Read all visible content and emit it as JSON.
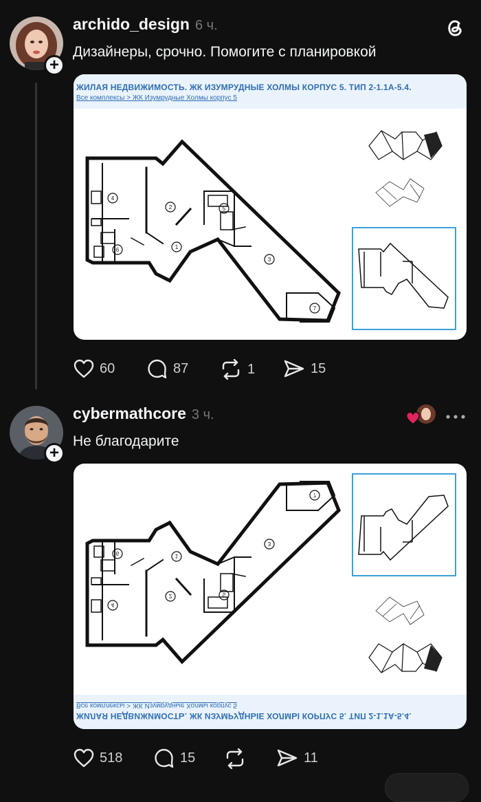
{
  "post1": {
    "username": "archido_design",
    "time": "6 ч.",
    "text": "Дизайнеры, срочно. Помогите с планировкой",
    "card": {
      "title": "ЖИЛАЯ НЕДВИЖИМОСТЬ. ЖК ИЗУМРУДНЫЕ ХОЛМЫ КОРПУС 5. ТИП 2-1.1А-5.4.",
      "breadcrumb": "Все комплексы > ЖК Изумрудные Холмы корпус 5",
      "rooms": [
        "1",
        "2",
        "3",
        "4",
        "5",
        "6",
        "7"
      ]
    },
    "actions": {
      "likes": "60",
      "comments": "87",
      "reposts": "1",
      "shares": "15"
    }
  },
  "post2": {
    "username": "cybermathcore",
    "time": "3 ч.",
    "text": "Не благодарите",
    "actions": {
      "likes": "518",
      "comments": "15",
      "reposts": "",
      "shares": "11"
    }
  },
  "colors": {
    "background": "#101010",
    "text": "#f3f5f7",
    "muted": "#777777",
    "like_red": "#e0245e",
    "plan_blue": "#2e6db4"
  },
  "icons": [
    "threads-logo-icon",
    "plus-icon",
    "heart-icon",
    "comment-icon",
    "repost-icon",
    "share-icon",
    "more-icon"
  ]
}
